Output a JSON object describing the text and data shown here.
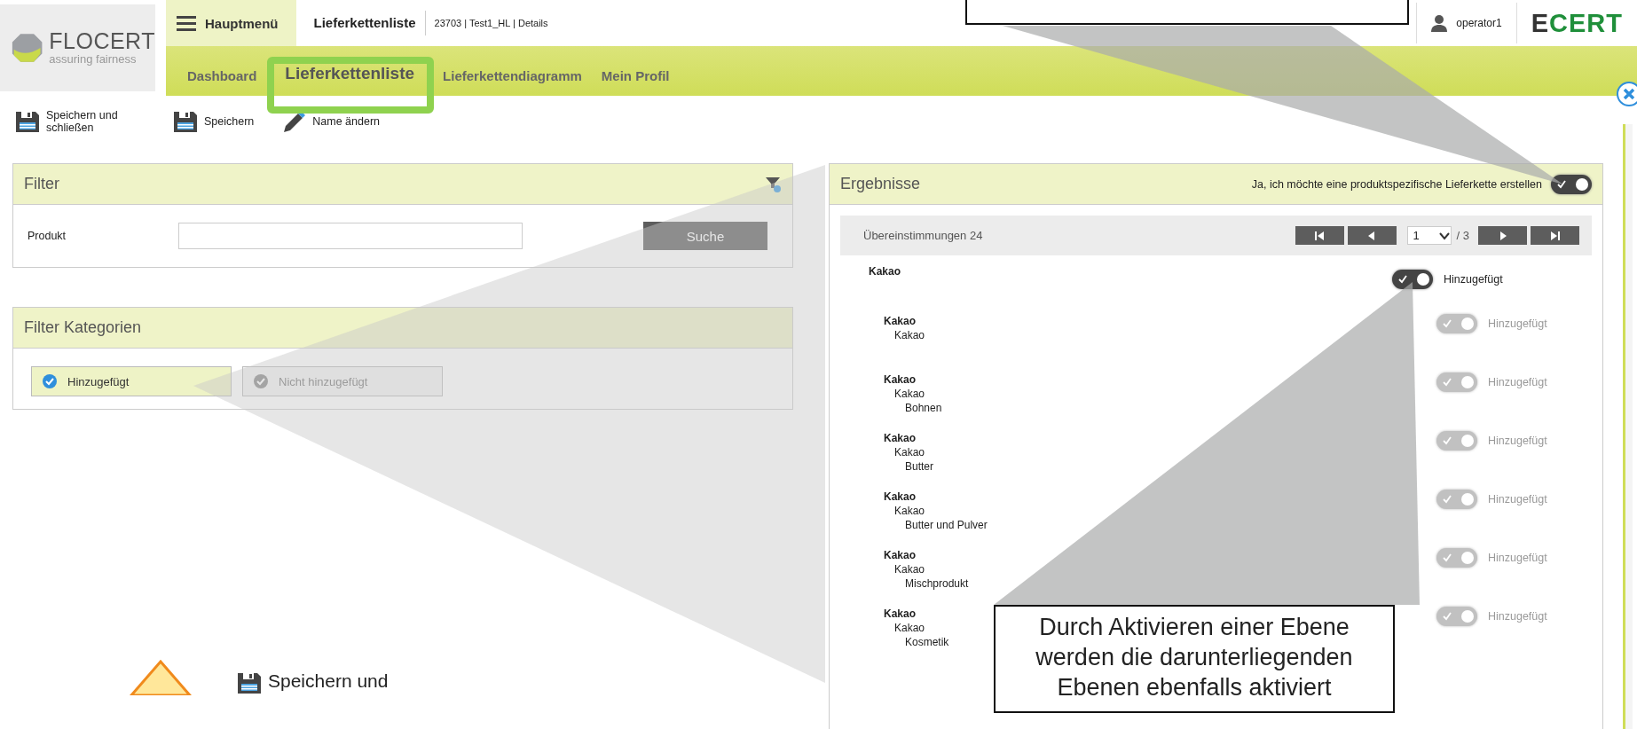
{
  "header": {
    "logo": {
      "name": "FLOCERT",
      "tagline": "assuring fairness"
    },
    "menu_button": "Hauptmenü",
    "page_title": "Lieferkettenliste",
    "breadcrumb": "23703 | Test1_HL | Details",
    "user": "operator1",
    "brand": "ECERT"
  },
  "nav_tabs": [
    {
      "label": "Dashboard",
      "selected": false
    },
    {
      "label": "Lieferkettenliste",
      "selected": true
    },
    {
      "label": "Lieferkettendiagramm",
      "selected": false
    },
    {
      "label": "Mein Profil",
      "selected": false
    }
  ],
  "toolbar": [
    {
      "label": "Speichern und schließen",
      "kind": "save"
    },
    {
      "label": "Speichern",
      "kind": "save"
    },
    {
      "label": "Name ändern",
      "kind": "edit"
    }
  ],
  "filter": {
    "title": "Filter",
    "field_label": "Produkt",
    "button": "Suche"
  },
  "filter_categories": {
    "title": "Filter Kategorien",
    "chips": [
      {
        "label": "Hinzugefügt",
        "selected": true
      },
      {
        "label": "Nicht hinzugefügt",
        "selected": false
      }
    ]
  },
  "results": {
    "title": "Ergebnisse",
    "switch_label": "Ja, ich möchte eine produktspezifische Lieferkette erstellen",
    "switch_on": true,
    "matches": "Übereinstimmungen 24",
    "page": "1",
    "page_total": "/ 3",
    "rows": [
      {
        "lines": [
          "Kakao"
        ],
        "on": true,
        "disabled": false,
        "status": "Hinzugefügt"
      },
      {
        "lines": [
          "Kakao",
          "Kakao"
        ],
        "on": true,
        "disabled": true,
        "status": "Hinzugefügt"
      },
      {
        "lines": [
          "Kakao",
          "Kakao",
          "Bohnen"
        ],
        "on": true,
        "disabled": true,
        "status": "Hinzugefügt"
      },
      {
        "lines": [
          "Kakao",
          "Kakao",
          "Butter"
        ],
        "on": true,
        "disabled": true,
        "status": "Hinzugefügt"
      },
      {
        "lines": [
          "Kakao",
          "Kakao",
          "Butter und Pulver"
        ],
        "on": true,
        "disabled": true,
        "status": "Hinzugefügt"
      },
      {
        "lines": [
          "Kakao",
          "Kakao",
          "Mischprodukt"
        ],
        "on": true,
        "disabled": true,
        "status": "Hinzugefügt"
      },
      {
        "lines": [
          "Kakao",
          "Kakao",
          "Kosmetik"
        ],
        "on": true,
        "disabled": true,
        "status": "Hinzugefügt"
      }
    ]
  },
  "annotations": {
    "callout_text": "Durch Aktivieren einer Ebene werden die darunterliegenden Ebenen ebenfalls aktiviert",
    "warning_label": "Speichern und"
  }
}
